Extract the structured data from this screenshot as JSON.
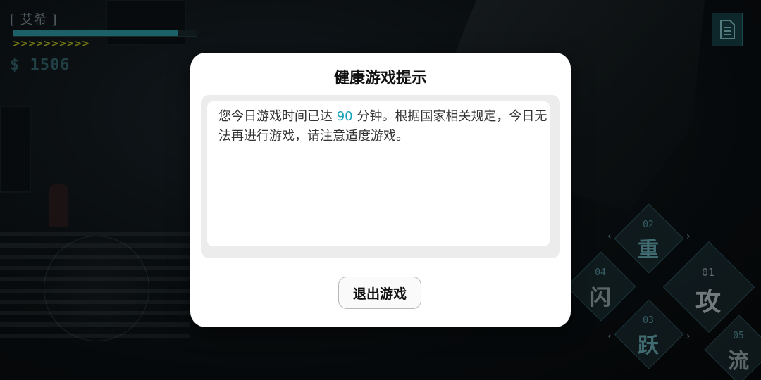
{
  "hud": {
    "player_name": "[ 艾希 ]",
    "hp_fraction": 0.9,
    "energy_chevrons": ">>>>>>>>>>",
    "money": "$ 1506",
    "menu_icon": "document-icon"
  },
  "skills": [
    {
      "id": "heavy",
      "number": "02",
      "label": "重"
    },
    {
      "id": "dodge",
      "number": "04",
      "label": "闪"
    },
    {
      "id": "attack",
      "number": "01",
      "label": "攻"
    },
    {
      "id": "jump",
      "number": "03",
      "label": "跃"
    },
    {
      "id": "flow",
      "number": "05",
      "label": "流"
    }
  ],
  "dialog": {
    "title": "健康游戏提示",
    "message_before": "您今日游戏时间已达 ",
    "minutes": "90",
    "message_after": " 分钟。根据国家相关规定，今日无法再进行游戏，请注意适度游戏。",
    "exit_button": "退出游戏",
    "minutes_color": "#1aa3b5"
  },
  "colors": {
    "accent": "#2fa7b2",
    "energy": "#cdd41f"
  }
}
